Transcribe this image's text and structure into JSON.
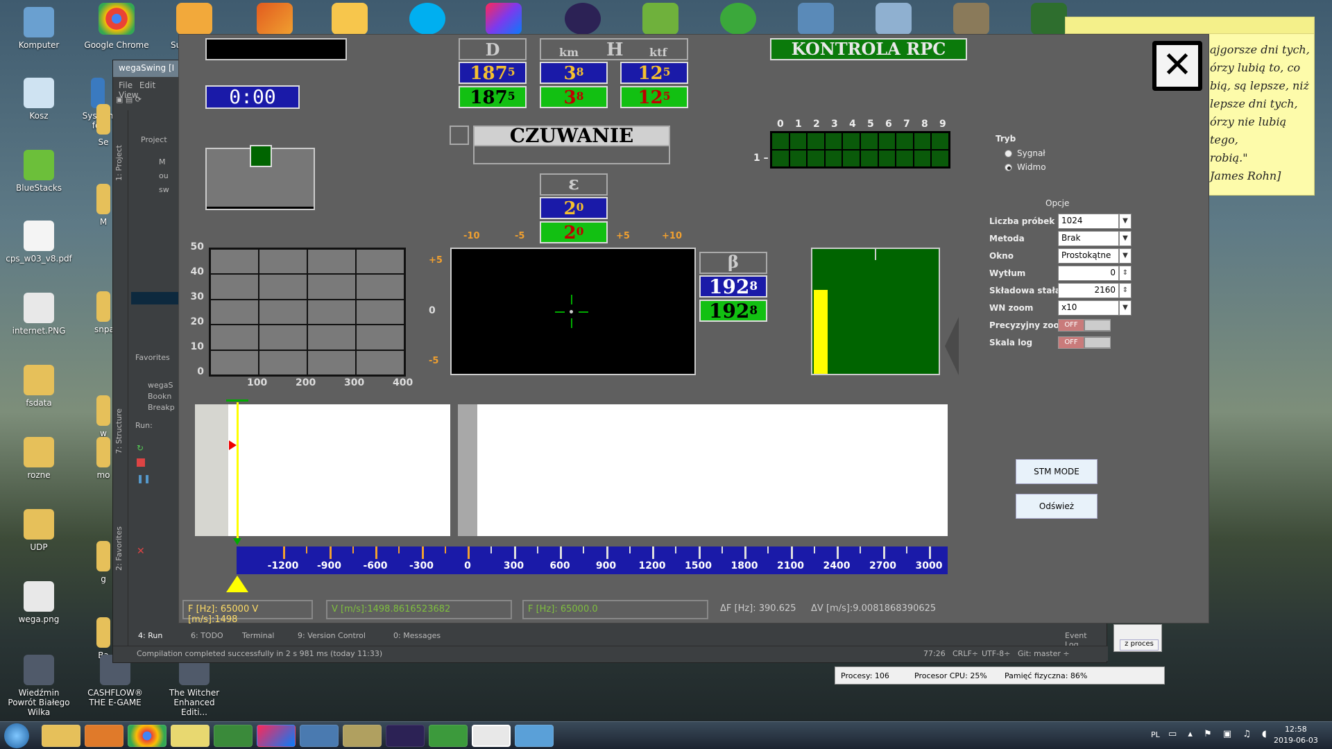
{
  "desktop": {
    "icons_left": [
      {
        "label": "Komputer",
        "icon": "computer-icon"
      },
      {
        "label": "Kosz",
        "icon": "recycle-bin-icon"
      },
      {
        "label": "BlueStacks",
        "icon": "bluestacks-icon"
      },
      {
        "label": "cps_w03_v8.pdf",
        "icon": "pdf-icon"
      },
      {
        "label": "internet.PNG",
        "icon": "image-file-icon"
      },
      {
        "label": "fsdata",
        "icon": "folder-icon"
      },
      {
        "label": "rozne",
        "icon": "folder-icon"
      },
      {
        "label": "UDP",
        "icon": "folder-icon"
      },
      {
        "label": "wega.png",
        "icon": "image-file-icon"
      },
      {
        "label": "Wiedźmin Powrót Białego Wilka",
        "icon": "game-icon"
      }
    ],
    "icons_second_col": [
      {
        "label": "Google Chrome",
        "icon": "chrome-icon"
      },
      {
        "label": "System for",
        "icon": "system-icon"
      },
      {
        "label": "Se",
        "icon": "folder-icon"
      },
      {
        "label": "M",
        "icon": "folder-icon"
      },
      {
        "label": "snpa",
        "icon": "folder-icon"
      },
      {
        "label": "w",
        "icon": "folder-icon"
      },
      {
        "label": "mo",
        "icon": "folder-icon"
      },
      {
        "label": "g",
        "icon": "folder-icon"
      },
      {
        "label": "Ba",
        "icon": "folder-icon"
      },
      {
        "label": "CASHFLOW® THE E-GAME",
        "icon": "game-icon"
      },
      {
        "label": "The Witcher Enhanced Editi...",
        "icon": "game-icon"
      }
    ],
    "top_icon_label_su": "Su"
  },
  "sticky_note": {
    "lines": [
      "ajgorsze dni tych,",
      "órzy lubią to, co",
      "bią, są lepsze, niż",
      "lepsze dni tych,",
      "órzy nie lubią tego,",
      "robią.\"",
      "James Rohn]"
    ]
  },
  "ide": {
    "title": "wegaSwing [I",
    "menu": [
      "File",
      "Edit",
      "View"
    ],
    "project_label": "wegaSwing",
    "project_tab": "Project",
    "tree_items": [
      "M",
      "ou",
      "sw"
    ],
    "favorites_label": "Favorites",
    "favorites_items": [
      "wegaS",
      "Bookn",
      "Breakp"
    ],
    "run_label": "Run:",
    "structure_tab": "7: Structure",
    "favorites_tab": "2: Favorites",
    "project_side_tab": "1: Project",
    "bottom_tabs": [
      "4: Run",
      "6: TODO",
      "Terminal",
      "9: Version Control",
      "0: Messages"
    ],
    "event_log": "Event Log",
    "status_message": "Compilation completed successfully in 2 s 981 ms (today 11:33)",
    "status_right": [
      "77:26",
      "CRLF÷",
      "UTF-8÷",
      "Git: master ÷"
    ]
  },
  "task_manager_status": {
    "procesy": "Procesy: 106",
    "cpu": "Procesor CPU: 25%",
    "pamiec": "Pamięć fizyczna: 86%",
    "button": "z proces"
  },
  "app": {
    "time": "0:00",
    "headers": {
      "d": "D",
      "km": "km",
      "h": "H",
      "ktf": "ktf",
      "kontrola": "KONTROLA RPC",
      "epsilon": "ε",
      "beta": "β"
    },
    "d_values": [
      {
        "main": "187",
        "dec": "5"
      },
      {
        "main": "187",
        "dec": "5"
      }
    ],
    "h_values": [
      {
        "main": "3",
        "dec": "8"
      },
      {
        "main": "3",
        "dec": "8"
      }
    ],
    "ktf_values": [
      {
        "main": "12",
        "dec": "5"
      },
      {
        "main": "12",
        "dec": "5"
      }
    ],
    "epsilon_values": [
      {
        "main": "2",
        "dec": "0"
      },
      {
        "main": "2",
        "dec": "0"
      }
    ],
    "beta_values": [
      {
        "main": "192",
        "dec": "8"
      },
      {
        "main": "192",
        "dec": "8"
      }
    ],
    "czuwanie": "CZUWANIE",
    "rpc_grid": {
      "cols": [
        "0",
        "1",
        "2",
        "3",
        "4",
        "5",
        "6",
        "7",
        "8",
        "9"
      ],
      "row_label": "1 –"
    },
    "left_chart": {
      "y_ticks": [
        "50",
        "40",
        "30",
        "20",
        "10",
        "0"
      ],
      "x_ticks": [
        "100",
        "200",
        "300",
        "400"
      ]
    },
    "scope": {
      "x_ticks": [
        "-10",
        "-5",
        "+5",
        "+10"
      ],
      "y_ticks": [
        "+5",
        "0",
        "-5"
      ]
    },
    "level_gauge": {
      "level_fraction": 0.67
    },
    "options": {
      "tryb_label": "Tryb",
      "tryb_options": [
        "Sygnał",
        "Widmo"
      ],
      "tryb_selected": "Widmo",
      "opcje_label": "Opcje",
      "rows": [
        {
          "label": "Liczba próbek",
          "value": "1024",
          "kind": "select"
        },
        {
          "label": "Metoda",
          "value": "Brak",
          "kind": "select"
        },
        {
          "label": "Okno",
          "value": "Prostokątne",
          "kind": "select"
        },
        {
          "label": "Wytłum",
          "value": "0",
          "kind": "spinner"
        },
        {
          "label": "Składowa stała",
          "value": "2160",
          "kind": "spinner"
        },
        {
          "label": "WN zoom",
          "value": "x10",
          "kind": "select"
        },
        {
          "label": "Precyzyjny zoom",
          "value": "OFF",
          "kind": "toggle"
        },
        {
          "label": "Skala log",
          "value": "OFF",
          "kind": "toggle"
        }
      ]
    },
    "buttons": {
      "stm": "STM MODE",
      "refresh": "Odśwież"
    },
    "freq_scale": [
      "-1200",
      "-900",
      "-600",
      "-300",
      "0",
      "300",
      "600",
      "900",
      "1200",
      "1500",
      "1800",
      "2100",
      "2400",
      "2700",
      "3000"
    ],
    "status": {
      "f_v": "F [Hz]: 65000   V [m/s]:1498",
      "v_field": "V [m/s]:1498.8616523682",
      "f_field": "F [Hz]: 65000.0",
      "delta_f": "ΔF [Hz]: 390.625",
      "delta_v": "ΔV [m/s]:9.0081868390625"
    }
  },
  "taskbar": {
    "lang": "PL",
    "time": "12:58",
    "date": "2019-06-03"
  },
  "colors": {
    "app_bg": "#5f5f5f",
    "blue_val": "#1a1aa8",
    "green_val": "#12c012",
    "amber": "#f4c030",
    "dark_green": "#006400",
    "yellow": "#ffff00"
  }
}
